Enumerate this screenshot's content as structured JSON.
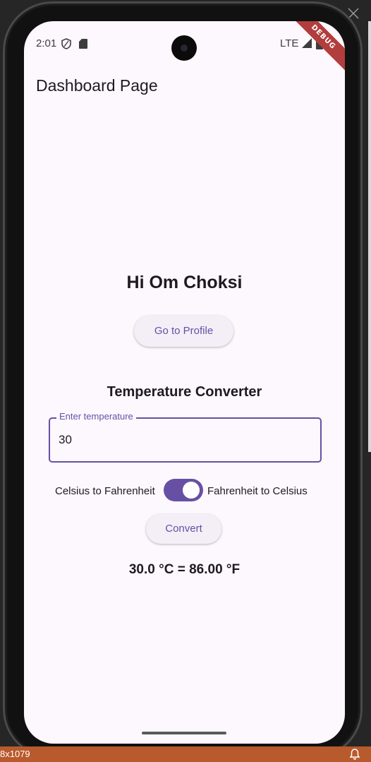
{
  "status_bar": {
    "time": "2:01",
    "network": "LTE"
  },
  "app_bar": {
    "title": "Dashboard Page"
  },
  "debug_banner": "DEBUG",
  "main": {
    "greeting": "Hi Om Choksi",
    "profile_button_label": "Go to Profile",
    "converter": {
      "title": "Temperature Converter",
      "input_label": "Enter temperature",
      "input_value": "30",
      "label_left": "Celsius to Fahrenheit",
      "label_right": "Fahrenheit to Celsius",
      "switch_on": true,
      "convert_button_label": "Convert",
      "result": "30.0 °C = 86.00 °F"
    }
  },
  "emulator": {
    "bottom_bar_text": "8x1079"
  },
  "colors": {
    "primary": "#6750a4",
    "surface": "#fdf7fe",
    "button_surface": "#f4eef7",
    "on_surface": "#1d1b20",
    "debug_ribbon": "#b13d3d",
    "ide_status_bar": "#b85a2c"
  },
  "icons": {
    "status_shield": "shield-icon",
    "status_sd": "sd-card-icon",
    "status_signal": "signal-icon",
    "status_battery": "battery-icon",
    "close": "close-icon",
    "notification": "notification-bell-icon"
  }
}
